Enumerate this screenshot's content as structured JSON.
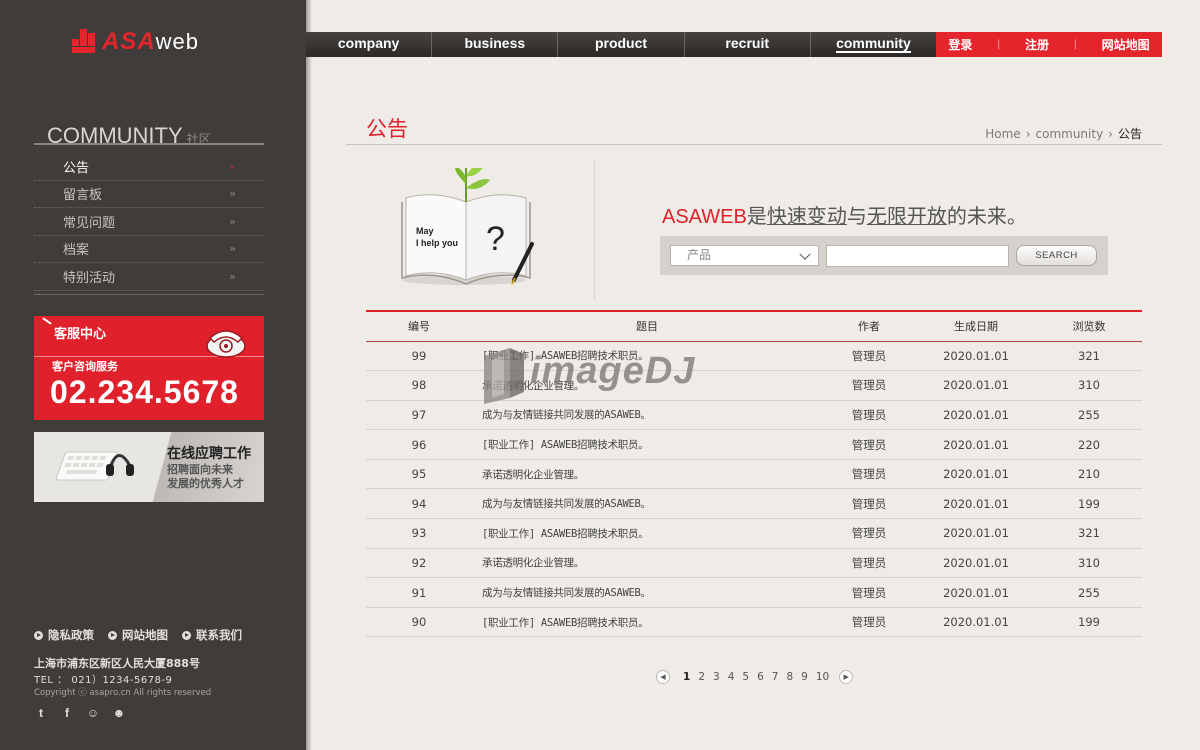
{
  "brand": {
    "logo_main": "ASA",
    "logo_suffix": "web"
  },
  "sidebar": {
    "section_title": "COMMUNITY",
    "section_title_cn": "社区",
    "items": [
      {
        "label": "公告",
        "active": true
      },
      {
        "label": "留言板",
        "active": false
      },
      {
        "label": "常见问题",
        "active": false
      },
      {
        "label": "档案",
        "active": false
      },
      {
        "label": "特别活动",
        "active": false
      }
    ],
    "customer_service": {
      "title": "客服中心",
      "subtitle": "客户咨询服务",
      "phone": "02.234.5678"
    },
    "job_banner": {
      "title": "在线应聘工作",
      "line1": "招聘面向未来",
      "line2": "发展的优秀人才"
    },
    "footer": {
      "links": [
        "隐私政策",
        "网站地图",
        "联系我们"
      ],
      "address": "上海市浦东区新区人民大厦888号",
      "tel": "TEL ： 021）1234-5678-9",
      "copyright": "Copyright ⓒ asapro.cn All rights reserved",
      "social": [
        "twitter-icon",
        "facebook-icon",
        "chat-icon",
        "robot-icon"
      ]
    }
  },
  "topnav": {
    "items": [
      {
        "label": "company",
        "active": false
      },
      {
        "label": "business",
        "active": false
      },
      {
        "label": "product",
        "active": false
      },
      {
        "label": "recruit",
        "active": false
      },
      {
        "label": "community",
        "active": true
      }
    ],
    "right_links": [
      "登录",
      "注册",
      "网站地图"
    ]
  },
  "page": {
    "title": "公告",
    "breadcrumb": [
      "Home",
      "community",
      "公告"
    ]
  },
  "hero": {
    "book_text_line1": "May",
    "book_text_line2": "I help you",
    "book_mark": "?",
    "slogan_brand": "ASAWEB",
    "slogan_p1": "是",
    "slogan_u1": "快速变动",
    "slogan_p2": "与",
    "slogan_u2": "无限开放",
    "slogan_p3": "的未来。"
  },
  "search": {
    "select_value": "产品",
    "input_value": "",
    "button_label": "SEARCH"
  },
  "table": {
    "headers": [
      "编号",
      "题目",
      "作者",
      "生成日期",
      "浏览数"
    ],
    "rows": [
      [
        "99",
        "[职业工作] ASAWEB招聘技术职员。",
        "管理员",
        "2020.01.01",
        "321"
      ],
      [
        "98",
        "承诺透明化企业管理。",
        "管理员",
        "2020.01.01",
        "310"
      ],
      [
        "97",
        "成为与友情链接共同发展的ASAWEB。",
        "管理员",
        "2020.01.01",
        "255"
      ],
      [
        "96",
        "[职业工作] ASAWEB招聘技术职员。",
        "管理员",
        "2020.01.01",
        "220"
      ],
      [
        "95",
        "承诺透明化企业管理。",
        "管理员",
        "2020.01.01",
        "210"
      ],
      [
        "94",
        "成为与友情链接共同发展的ASAWEB。",
        "管理员",
        "2020.01.01",
        "199"
      ],
      [
        "93",
        "[职业工作] ASAWEB招聘技术职员。",
        "管理员",
        "2020.01.01",
        "321"
      ],
      [
        "92",
        "承诺透明化企业管理。",
        "管理员",
        "2020.01.01",
        "310"
      ],
      [
        "91",
        "成为与友情链接共同发展的ASAWEB。",
        "管理员",
        "2020.01.01",
        "255"
      ],
      [
        "90",
        "[职业工作] ASAWEB招聘技术职员。",
        "管理员",
        "2020.01.01",
        "199"
      ]
    ]
  },
  "pagination": {
    "pages": [
      "1",
      "2",
      "3",
      "4",
      "5",
      "6",
      "7",
      "8",
      "9",
      "10"
    ],
    "current": "1"
  },
  "watermark": "imageDJ",
  "colors": {
    "accent": "#e0202a",
    "sidebar": "#3f3c39",
    "background": "#efebe6"
  }
}
